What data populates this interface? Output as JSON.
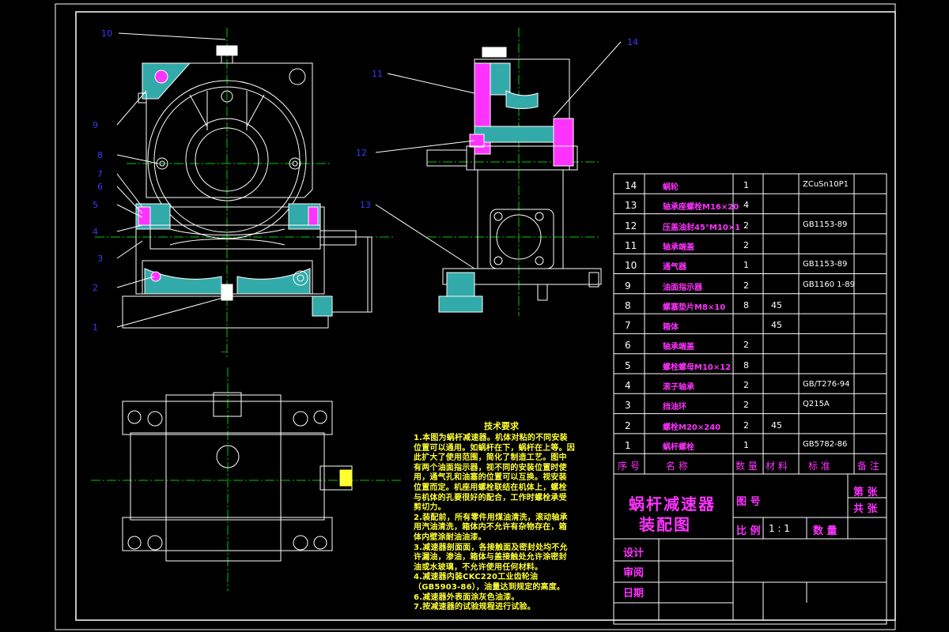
{
  "colors": {
    "background": "#000000",
    "outline": "#ffffff",
    "centerline": "#00cc00",
    "section_fill": "#33aaaa",
    "magenta": "#ff33ff",
    "label_blue": "#3a3aff",
    "notes_yellow": "#ffff33"
  },
  "drawing": {
    "scale_mark": "---"
  },
  "callouts": [
    "10",
    "9",
    "8",
    "7",
    "6",
    "5",
    "4",
    "3",
    "2",
    "1",
    "11",
    "12",
    "13",
    "14"
  ],
  "bom": {
    "headers": [
      "序 号",
      "名  称",
      "数 量",
      "材 料",
      "标 准",
      "备 注"
    ],
    "rows": [
      {
        "no": "14",
        "name": "蜗轮",
        "qty": "1",
        "material": "",
        "standard": "ZCuSn10P1",
        "remark": ""
      },
      {
        "no": "13",
        "name": "轴承座螺栓M16×20",
        "qty": "4",
        "material": "",
        "standard": "",
        "remark": ""
      },
      {
        "no": "12",
        "name": "压盖油封45°M10×1",
        "qty": "2",
        "material": "",
        "standard": "GB1153-89",
        "remark": ""
      },
      {
        "no": "11",
        "name": "轴承端盖",
        "qty": "2",
        "material": "",
        "standard": "",
        "remark": ""
      },
      {
        "no": "10",
        "name": "通气器",
        "qty": "1",
        "material": "",
        "standard": "GB1153-89",
        "remark": ""
      },
      {
        "no": "9",
        "name": "油面指示器",
        "qty": "2",
        "material": "",
        "standard": "GB1160 1-89",
        "remark": ""
      },
      {
        "no": "8",
        "name": "螺塞垫片M8×10",
        "qty": "8",
        "material": "45",
        "standard": "",
        "remark": ""
      },
      {
        "no": "7",
        "name": "箱体",
        "qty": "",
        "material": "45",
        "standard": "",
        "remark": ""
      },
      {
        "no": "6",
        "name": "轴承端盖",
        "qty": "2",
        "material": "",
        "standard": "",
        "remark": ""
      },
      {
        "no": "5",
        "name": "螺栓螺母M10×12",
        "qty": "8",
        "material": "",
        "standard": "",
        "remark": ""
      },
      {
        "no": "4",
        "name": "滚子轴承",
        "qty": "2",
        "material": "",
        "standard": "GB/T276-94",
        "remark": ""
      },
      {
        "no": "3",
        "name": "挡油环",
        "qty": "2",
        "material": "",
        "standard": "Q215A",
        "remark": ""
      },
      {
        "no": "2",
        "name": "螺栓M20×240",
        "qty": "2",
        "material": "45",
        "standard": "",
        "remark": ""
      },
      {
        "no": "1",
        "name": "蜗杆螺栓",
        "qty": "1",
        "material": "",
        "standard": "GB5782-86",
        "remark": ""
      }
    ]
  },
  "title_block": {
    "title": "蜗杆减速器",
    "subtitle": "装配图",
    "drawing_no_label": "图 号",
    "scale_label": "比 例",
    "scale_value": "1 : 1",
    "qty_label": "数 量",
    "sheet_label": "第 张",
    "total_label": "共 张",
    "design_label": "设计",
    "review_label": "审阅",
    "date_label": "日期"
  },
  "notes": {
    "title": "技术要求",
    "lines": [
      "1.本图为蜗杆减速器。机体对粘的不同安装",
      "位置可以通用。如蜗杆在下，蜗杆在上等。因",
      "此扩大了使用范围，简化了制造工艺。图中",
      "有两个油面指示器，视不同的安装位置时使",
      "用，通气孔和油塞的位置可以互换。视安装",
      "位置而定。机座用螺栓联结在机体上，螺栓",
      "与机体的孔要很好的配合，工作时螺栓承受",
      "剪切力。",
      "2.装配前，所有零件用煤油清洗，滚动轴承",
      "用汽油清洗，箱体内不允许有杂物存在，箱",
      "体内壁涂耐油油漆。",
      "3.减速器剖面面，各接触面及密封处均不允",
      "许漏油，渗油，箱体与盖接触处允许涂密封",
      "油或水玻璃，不允许使用任何材料。",
      "4.减速器内装CKC220工业齿轮油",
      "（GB5903-86），油量达到规定的高度。",
      "6.减速器外表面涂灰色油漆。",
      "7.按减速器的试验规程进行试验。"
    ]
  }
}
